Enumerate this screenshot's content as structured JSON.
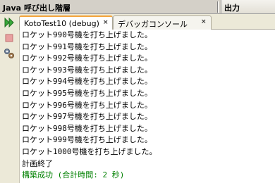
{
  "header": {
    "title": "Java 呼び出し階層",
    "output_title": "出力"
  },
  "tabs": [
    {
      "label": "KotoTest10 (debug)",
      "close": "×"
    },
    {
      "label": "デバッガコンソール",
      "close": "×"
    }
  ],
  "console": {
    "lines": [
      "ロケット990号機を打ち上げました。",
      "ロケット991号機を打ち上げました。",
      "ロケット992号機を打ち上げました。",
      "ロケット993号機を打ち上げました。",
      "ロケット994号機を打ち上げました。",
      "ロケット995号機を打ち上げました。",
      "ロケット996号機を打ち上げました。",
      "ロケット997号機を打ち上げました。",
      "ロケット998号機を打ち上げました。",
      "ロケット999号機を打ち上げました。",
      "ロケット1000号機を打ち上げました。",
      "計画終了",
      "構築成功 (合計時間: 2 秒)"
    ]
  },
  "icons": {
    "run": "run-icon",
    "stop": "stop-icon",
    "settings": "debug-settings-icon"
  },
  "colors": {
    "success_text": "#008000",
    "active_tab_accent": "#f3a33b",
    "run_icon": "#3aa83a",
    "stop_icon": "#e07070"
  }
}
